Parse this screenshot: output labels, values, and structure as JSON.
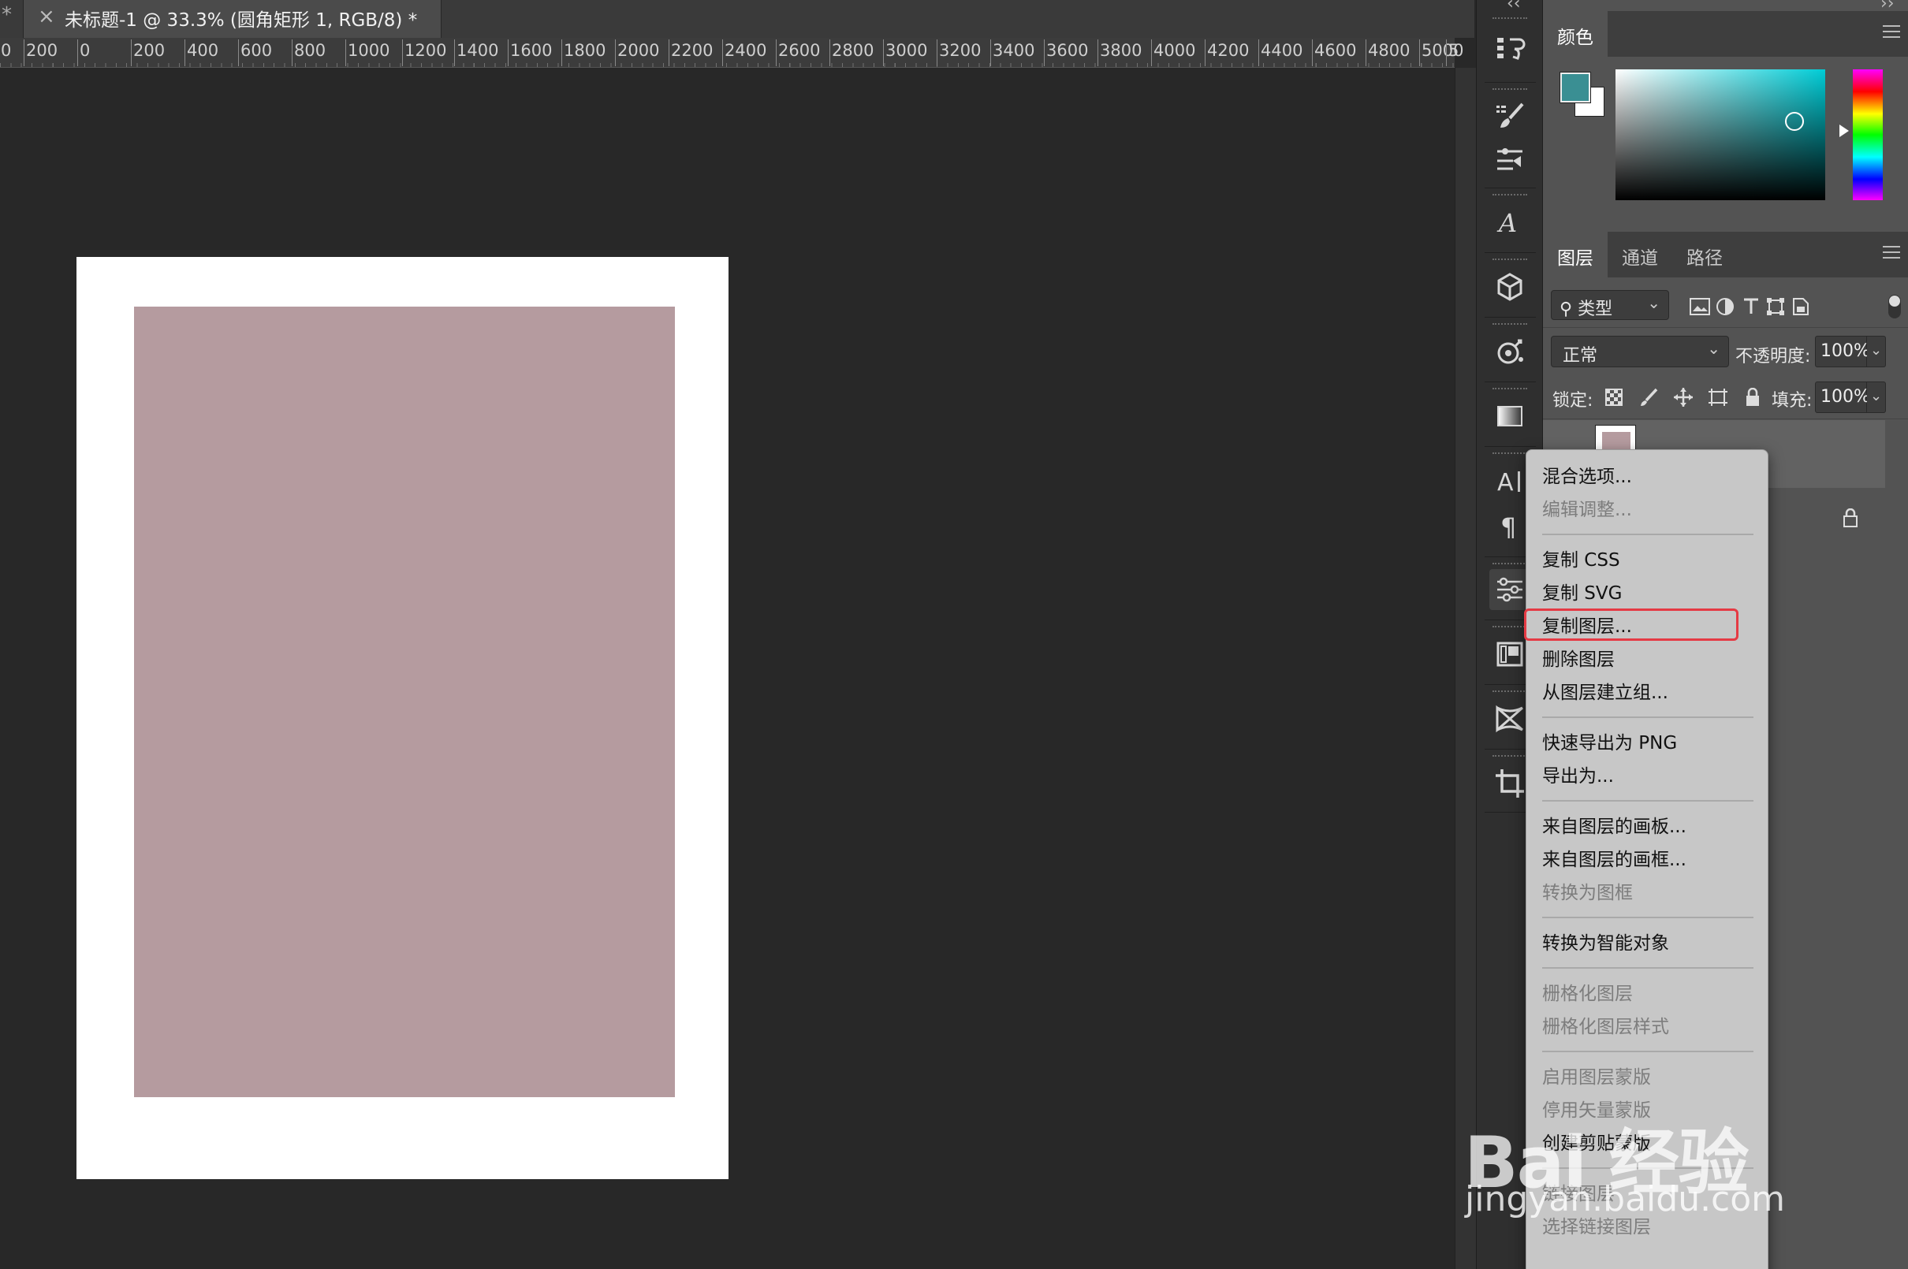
{
  "tabs": {
    "edge_label": "*",
    "close_glyph": "×",
    "document_title": "未标题-1 @ 33.3% (圆角矩形 1, RGB/8) *"
  },
  "ruler": {
    "labels": [
      "0",
      "200",
      "0",
      "200",
      "400",
      "600",
      "800",
      "1000",
      "1200",
      "1400",
      "1600",
      "1800",
      "2000",
      "2200",
      "2400",
      "2600",
      "2800",
      "3000",
      "3200",
      "3400",
      "3600",
      "3800",
      "4000",
      "4200",
      "4400",
      "4600",
      "4800",
      "5000",
      "5"
    ]
  },
  "canvas": {
    "artboard_color": "#ffffff",
    "shape_color": "#b59b9f",
    "shape_name": "圆角矩形 1"
  },
  "toolstrip": {
    "collapse_left": "‹‹",
    "collapse_right": "››",
    "tools": [
      "history-icon",
      "brush-settings-icon",
      "adjustments-sliders-icon",
      "glyph-script-icon",
      "3d-cube-icon",
      "properties-target-icon",
      "gradient-icon",
      "character-icon",
      "paragraph-icon",
      "adjustments-panel-icon",
      "artboard-icon",
      "3d-move-icon",
      "crop-icon"
    ]
  },
  "color_panel": {
    "tab": "颜色",
    "foreground": "#3a8f93",
    "background": "#ffffff",
    "hue_color": "#00ccd6"
  },
  "layers_panel": {
    "tabs": [
      "图层",
      "通道",
      "路径"
    ],
    "filter": {
      "kind_label": "类型"
    },
    "blend_mode": "正常",
    "opacity_label": "不透明度:",
    "opacity_value": "100%",
    "lock_label": "锁定:",
    "fill_label": "填充:",
    "fill_value": "100%"
  },
  "context_menu": {
    "items": [
      {
        "label": "混合选项...",
        "enabled": true
      },
      {
        "label": "编辑调整...",
        "enabled": false
      },
      {
        "sep": true
      },
      {
        "label": "复制 CSS",
        "enabled": true
      },
      {
        "label": "复制 SVG",
        "enabled": true
      },
      {
        "label": "复制图层...",
        "enabled": true,
        "highlighted": true
      },
      {
        "label": "删除图层",
        "enabled": true
      },
      {
        "label": "从图层建立组...",
        "enabled": true
      },
      {
        "sep": true
      },
      {
        "label": "快速导出为 PNG",
        "enabled": true
      },
      {
        "label": "导出为...",
        "enabled": true
      },
      {
        "sep": true
      },
      {
        "label": "来自图层的画板...",
        "enabled": true
      },
      {
        "label": "来自图层的画框...",
        "enabled": true
      },
      {
        "label": "转换为图框",
        "enabled": false
      },
      {
        "sep": true
      },
      {
        "label": "转换为智能对象",
        "enabled": true
      },
      {
        "sep": true
      },
      {
        "label": "栅格化图层",
        "enabled": false
      },
      {
        "label": "栅格化图层样式",
        "enabled": false
      },
      {
        "sep": true
      },
      {
        "label": "启用图层蒙版",
        "enabled": false
      },
      {
        "label": "停用矢量蒙版",
        "enabled": false
      },
      {
        "label": "创建剪贴蒙版",
        "enabled": true
      },
      {
        "sep": true
      },
      {
        "label": "链接图层",
        "enabled": false
      },
      {
        "label": "选择链接图层",
        "enabled": false
      }
    ],
    "highlight_color": "#e53a44"
  },
  "watermark": {
    "main": "Bai 经验",
    "sub": "jingyan.baidu.com"
  }
}
